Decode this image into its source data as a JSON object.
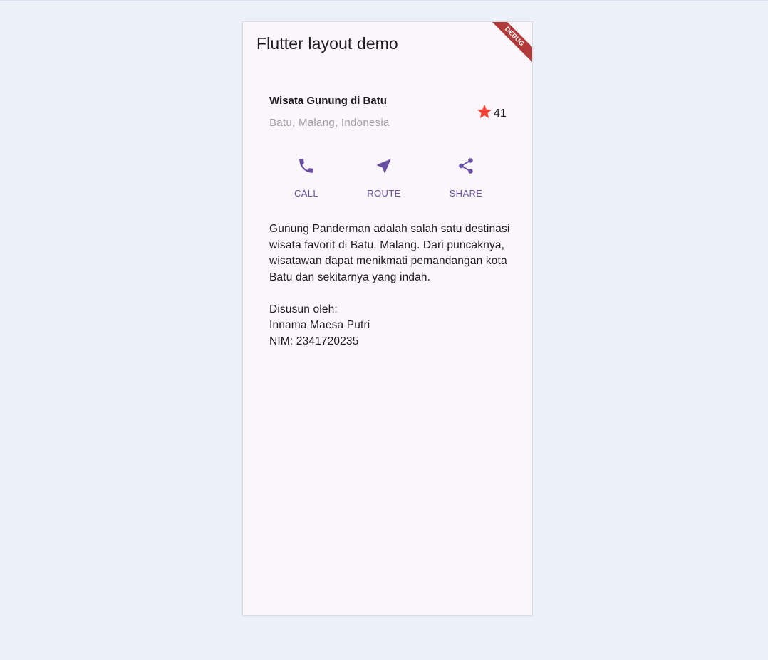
{
  "app_bar": {
    "title": "Flutter layout demo",
    "debug_banner": "DEBUG"
  },
  "title_section": {
    "name": "Wisata Gunung di Batu",
    "location": "Batu, Malang, Indonesia",
    "rating_icon": "star-icon",
    "rating_count": "41"
  },
  "buttons": {
    "call": {
      "label": "CALL",
      "icon": "phone-icon"
    },
    "route": {
      "label": "ROUTE",
      "icon": "navigation-icon"
    },
    "share": {
      "label": "SHARE",
      "icon": "share-icon"
    }
  },
  "text_section": {
    "description": "Gunung Panderman adalah salah satu destinasi wisata favorit di Batu, Malang. Dari puncaknya, wisatawan dapat menikmati pemandangan kota Batu dan sekitarnya yang indah.\n\nDisusun oleh:\nInnama Maesa Putri\nNIM: 2341720235"
  },
  "colors": {
    "page_background": "#ecf0f8",
    "app_background": "#fbf5fc",
    "accent": "#6750a4",
    "star": "#f44336",
    "debug_banner": "#b13a3a"
  }
}
